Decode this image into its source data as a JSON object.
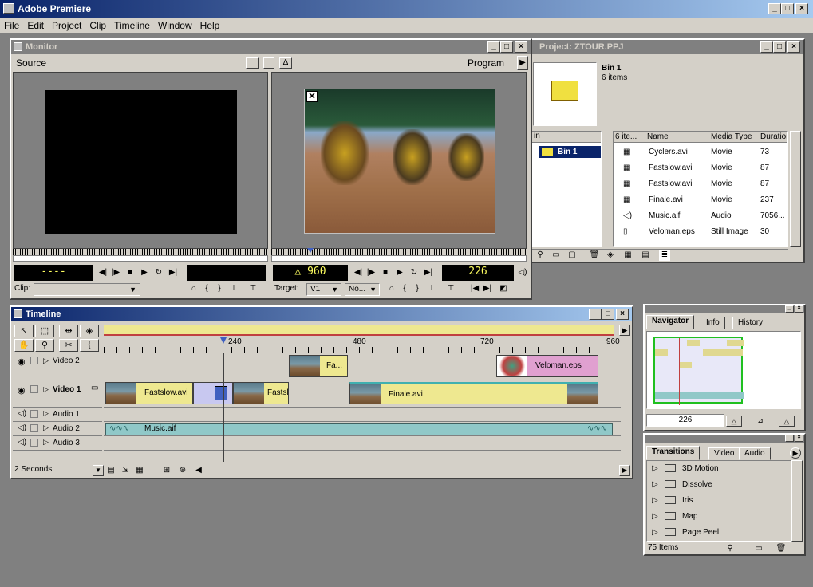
{
  "app": {
    "title": "Adobe Premiere"
  },
  "menu": [
    "File",
    "Edit",
    "Project",
    "Clip",
    "Timeline",
    "Window",
    "Help"
  ],
  "monitor": {
    "title": "Monitor",
    "source_label": "Source",
    "program_label": "Program",
    "source_tc_left": "----",
    "program_tc_left": "△ 960",
    "program_tc_right": "226",
    "clip_label": "Clip:",
    "target_label": "Target:",
    "target_value": "V1",
    "target2_value": "No..."
  },
  "project": {
    "title": "Project: ZTOUR.PPJ",
    "bin_name": "Bin 1",
    "bin_count": "6 items",
    "bin_col_header": "in",
    "bin_list_item": "Bin 1",
    "columns": [
      "6 ite...",
      "Name",
      "Media Type",
      "Duration"
    ],
    "items": [
      {
        "name": "Cyclers.avi",
        "type": "Movie",
        "duration": "73",
        "icon": "film-icon"
      },
      {
        "name": "Fastslow.avi",
        "type": "Movie",
        "duration": "87",
        "icon": "film-icon"
      },
      {
        "name": "Fastslow.avi",
        "type": "Movie",
        "duration": "87",
        "icon": "film-icon"
      },
      {
        "name": "Finale.avi",
        "type": "Movie",
        "duration": "237",
        "icon": "film-icon"
      },
      {
        "name": "Music.aif",
        "type": "Audio",
        "duration": "7056...",
        "icon": "speaker-icon"
      },
      {
        "name": "Veloman.eps",
        "type": "Still Image",
        "duration": "30",
        "icon": "document-icon"
      }
    ]
  },
  "timeline": {
    "title": "Timeline",
    "ruler": [
      "240",
      "480",
      "720",
      "960"
    ],
    "tracks": {
      "video2": "Video 2",
      "video1": "Video 1",
      "audio1": "Audio 1",
      "audio2": "Audio 2",
      "audio3": "Audio 3"
    },
    "clips": {
      "v2_fa": "Fa...",
      "v2_veloman": "Veloman.eps",
      "v1_fastslow": "Fastslow.avi",
      "v1_fastsl": "Fastsl...",
      "v1_finale": "Finale.avi",
      "a2_music": "Music.aif"
    },
    "time_unit": "2 Seconds"
  },
  "navigator": {
    "tabs": [
      "Navigator",
      "Info",
      "History"
    ],
    "timecode": "226"
  },
  "transitions": {
    "tabs": [
      "Transitions",
      "Video",
      "Audio"
    ],
    "items": [
      "3D Motion",
      "Dissolve",
      "Iris",
      "Map",
      "Page Peel"
    ],
    "count": "75 Items"
  }
}
